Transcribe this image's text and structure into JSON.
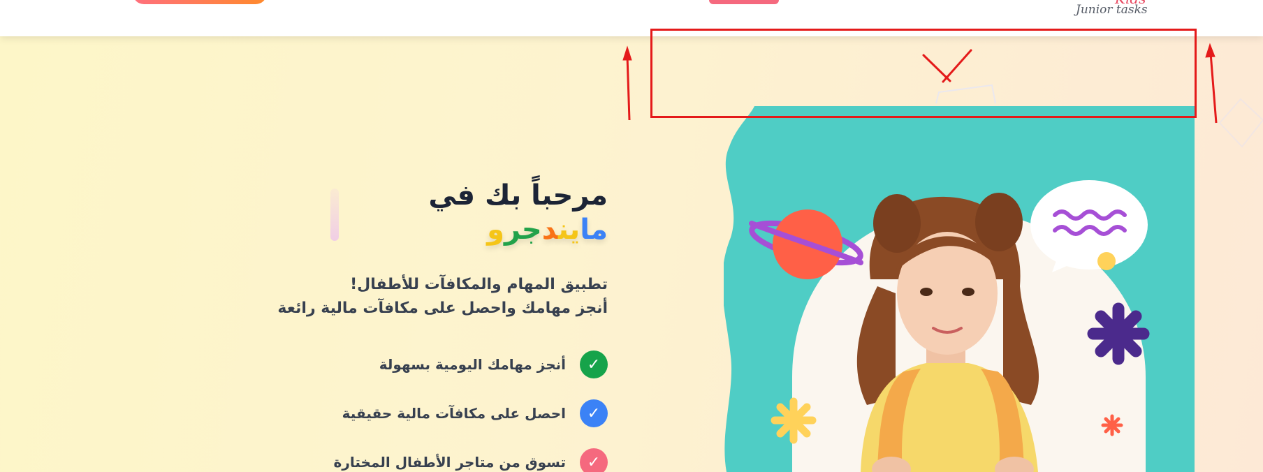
{
  "header": {
    "logo": {
      "script": "Kids",
      "text": "Junior tasks"
    }
  },
  "hero": {
    "welcome": "مرحباً بك في",
    "brand_letters": [
      {
        "char": "ما",
        "color": "#3b82f6"
      },
      {
        "char": "ين",
        "color": "#f5c518"
      },
      {
        "char": "د",
        "color": "#f97316"
      },
      {
        "char": "جر",
        "color": "#22a24a"
      },
      {
        "char": "و",
        "color": "#f5c518"
      }
    ],
    "subtitle_line1": "تطبيق المهام والمكافآت للأطفال!",
    "subtitle_line2": "أنجز مهامك واحصل على مكافآت مالية رائعة",
    "features": [
      {
        "label": "أنجز مهامك اليومية بسهولة",
        "color": "#16a34a",
        "icon": "check-icon"
      },
      {
        "label": "احصل على مكافآت مالية حقيقية",
        "color": "#3b82f6",
        "icon": "check-icon"
      },
      {
        "label": "تسوق من متاجر الأطفال المختارة",
        "color": "#f5697e",
        "icon": "check-icon"
      }
    ],
    "check_glyph": "✓"
  },
  "colors": {
    "teal": "#4fcdc5",
    "planet": "#ff6047",
    "ring": "#a64fd6",
    "star_purple": "#4b2a8c",
    "star_yellow": "#ffd25a",
    "annotation_red": "#e41a1a"
  }
}
